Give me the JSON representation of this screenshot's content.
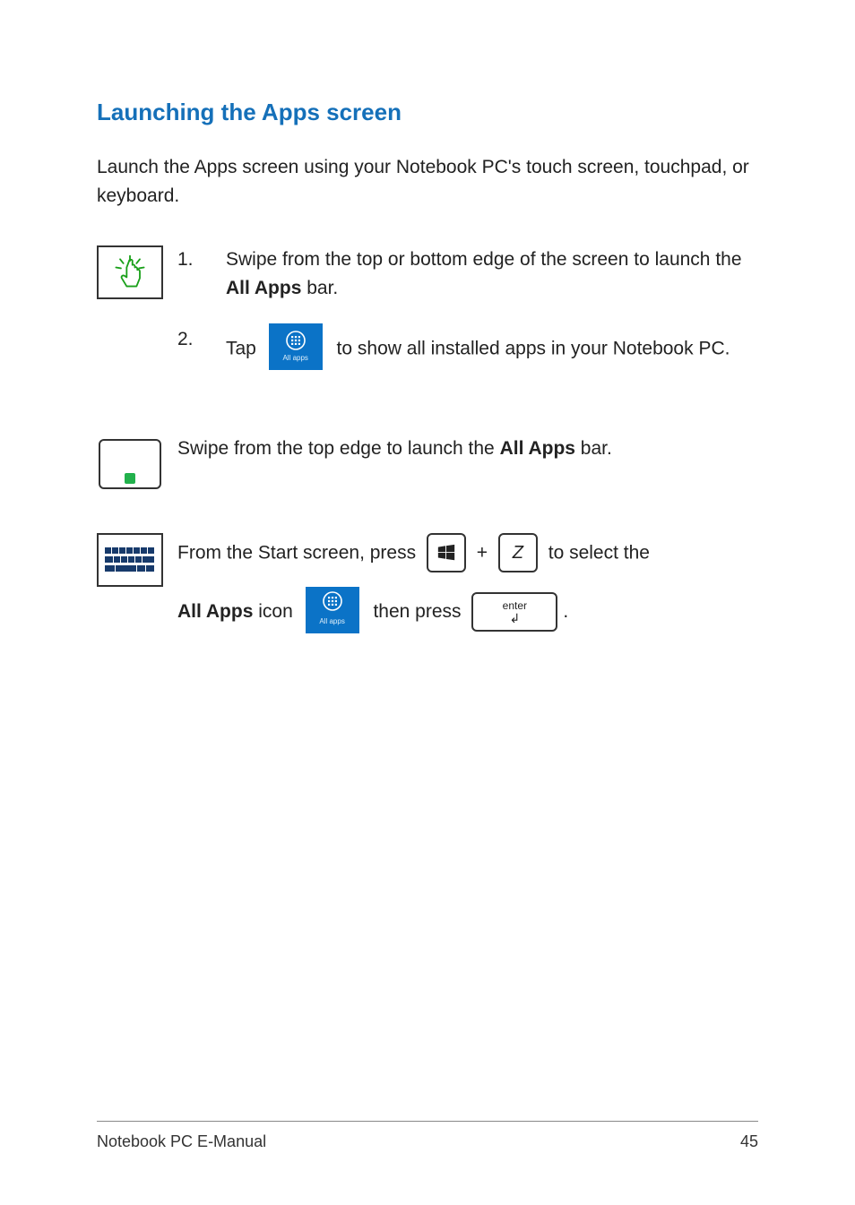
{
  "heading": "Launching the Apps screen",
  "intro": "Launch the Apps screen using your Notebook PC's touch screen, touchpad, or keyboard.",
  "touch": {
    "step1_num": "1.",
    "step1_text_a": "Swipe from the top or bottom edge of the screen to launch the ",
    "step1_bold": "All Apps",
    "step1_text_b": " bar.",
    "step2_num": "2.",
    "step2_text_a": "Tap",
    "step2_text_b": "to show all installed apps in your Notebook PC."
  },
  "touchpad": {
    "text_a": "Swipe from the top edge to launch the ",
    "bold": "All Apps",
    "text_b": " bar."
  },
  "keyboard": {
    "line1_a": "From the Start screen, press",
    "plus": "+",
    "key_z": "Z",
    "line1_b": "to select the",
    "line2_bold": "All Apps",
    "line2_a": " icon",
    "line2_b": "then press",
    "period": "."
  },
  "allapps_label": "All apps",
  "enter_label": "enter",
  "footer": {
    "title": "Notebook PC E-Manual",
    "page": "45"
  }
}
